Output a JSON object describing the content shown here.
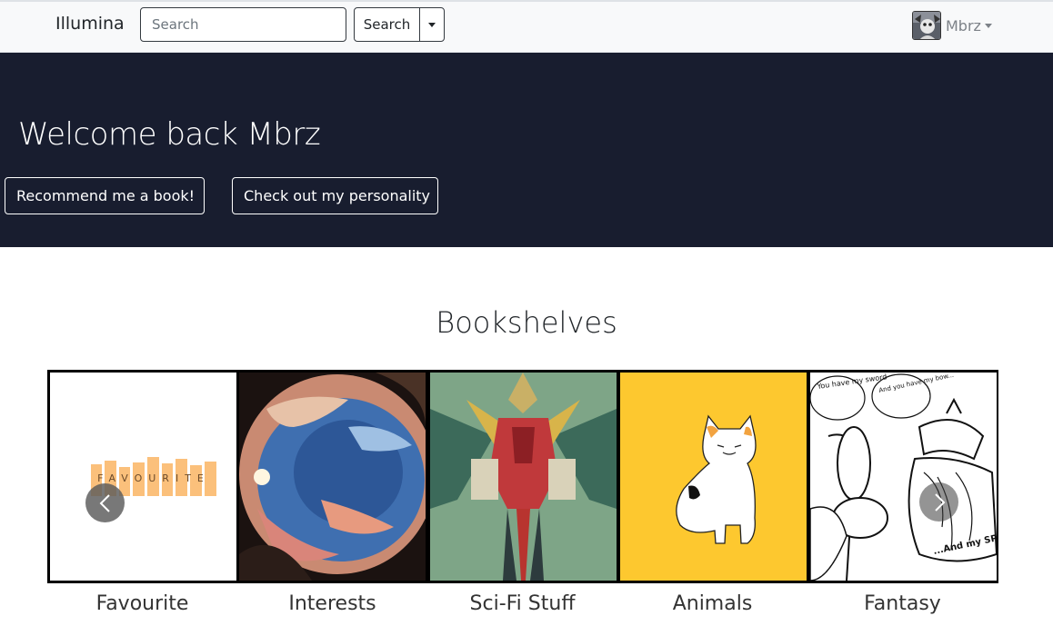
{
  "navbar": {
    "brand": "Illumina",
    "search_placeholder": "Search",
    "search_label": "Search",
    "user_name": "Mbrz"
  },
  "hero": {
    "title": "Welcome back Mbrz",
    "recommend_label": "Recommend me a book!",
    "personality_label": "Check out my personality"
  },
  "bookshelves": {
    "title": "Bookshelves",
    "favourite_cover_text": "FAVOURITE",
    "fantasy_bubble_1": "You have my sword",
    "fantasy_bubble_2": "And you have my bow...",
    "fantasy_bubble_3": "...And my SPORK",
    "items": [
      {
        "label": "Favourite"
      },
      {
        "label": "Interests"
      },
      {
        "label": "Sci-Fi Stuff"
      },
      {
        "label": "Animals"
      },
      {
        "label": "Fantasy"
      }
    ]
  },
  "colors": {
    "hero_bg": "#181d2f",
    "navbar_bg": "#f8f9fa",
    "favourite_tile": "#fbc07b",
    "animals_bg": "#fdc82f"
  }
}
